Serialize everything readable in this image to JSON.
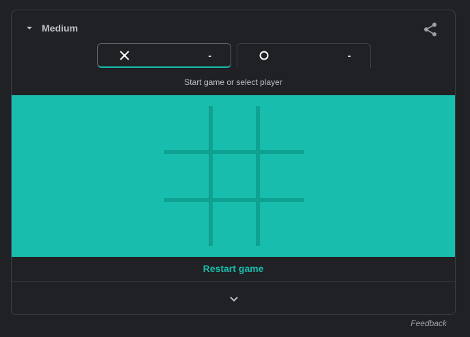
{
  "header": {
    "difficulty_label": "Medium",
    "share_icon": "share-icon",
    "dropdown_icon": "caret-down-icon"
  },
  "players": [
    {
      "mark": "X",
      "icon": "x-mark-icon",
      "score": "-",
      "selected": true
    },
    {
      "mark": "O",
      "icon": "o-mark-icon",
      "score": "-",
      "selected": false
    }
  ],
  "status_text": "Start game or select player",
  "board": {
    "cells": [
      "",
      "",
      "",
      "",
      "",
      "",
      "",
      "",
      ""
    ]
  },
  "actions": {
    "restart_label": "Restart game",
    "expand_icon": "chevron-down-icon"
  },
  "footer": {
    "feedback_label": "Feedback"
  },
  "colors": {
    "accent": "#18bdad",
    "grid_line": "#0fa192",
    "background": "#202124",
    "text": "#bdc1c6"
  }
}
